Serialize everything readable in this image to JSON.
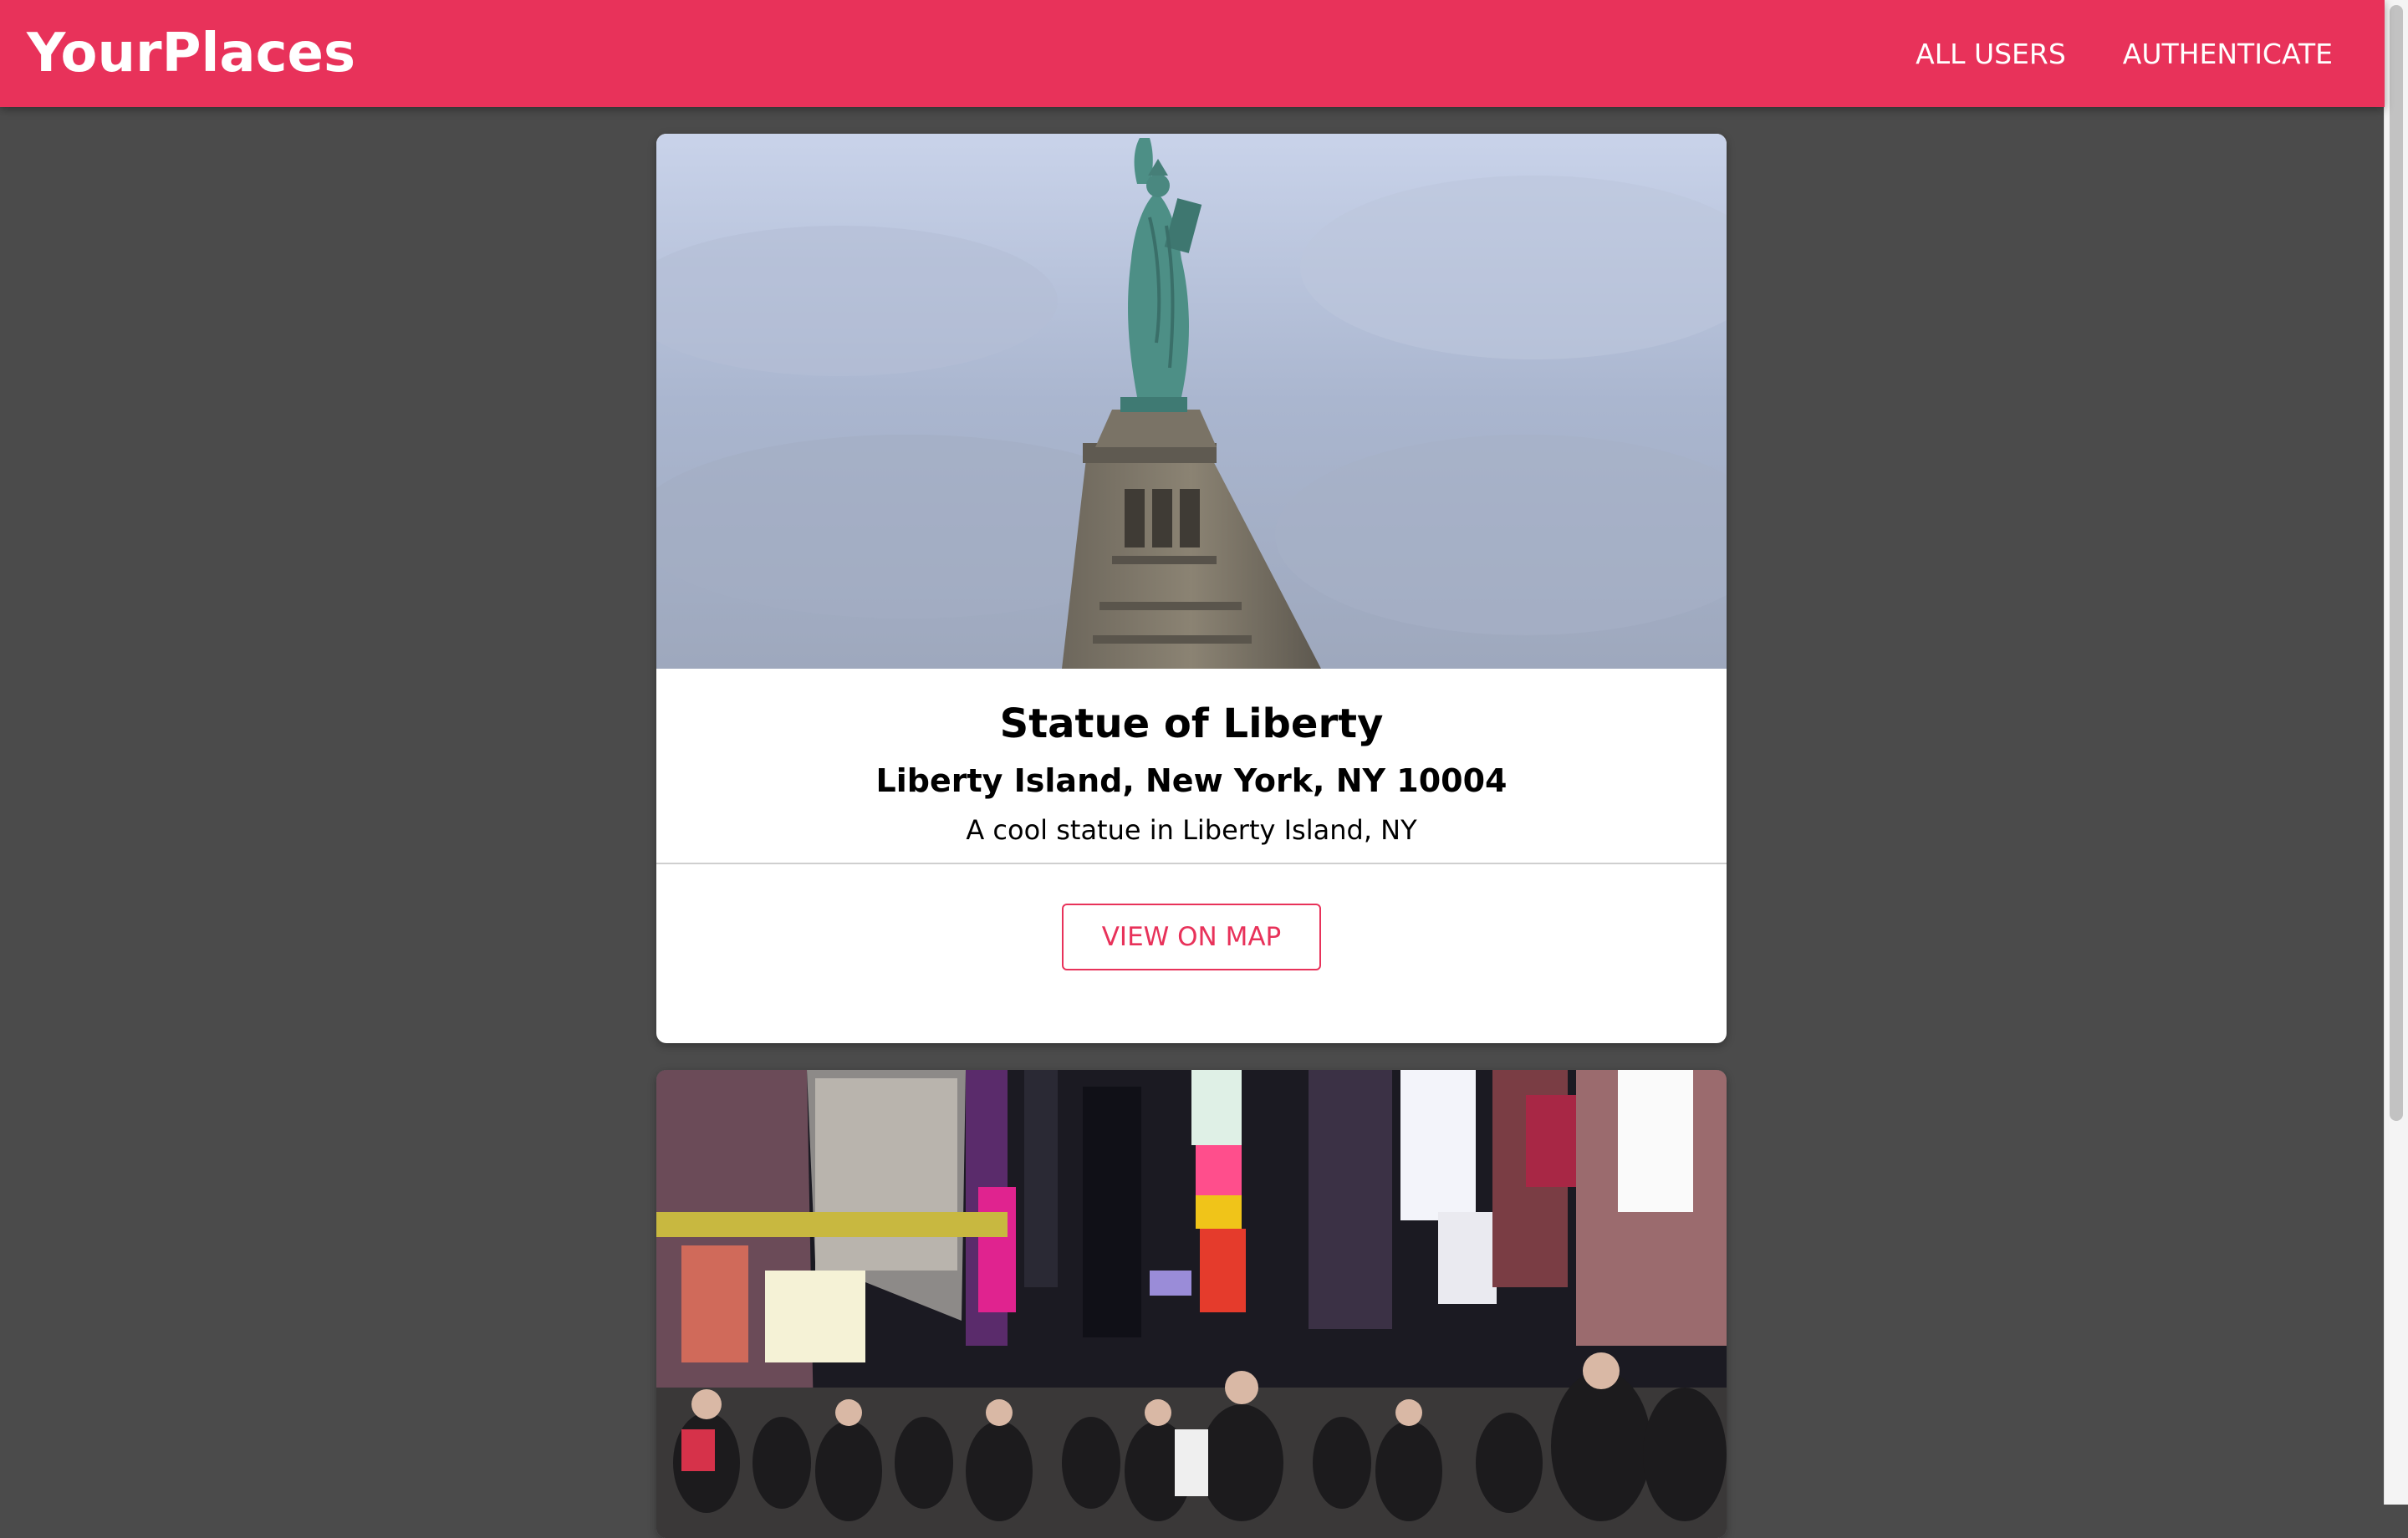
{
  "header": {
    "logo": "YourPlaces",
    "nav": [
      {
        "label": "ALL USERS"
      },
      {
        "label": "AUTHENTICATE"
      }
    ]
  },
  "places": [
    {
      "title": "Statue of Liberty",
      "address": "Liberty Island, New York, NY 10004",
      "description": "A cool statue in Liberty Island, NY",
      "action_label": "VIEW ON MAP",
      "image_subject": "statue-of-liberty-photo"
    },
    {
      "image_subject": "times-square-photo"
    }
  ],
  "colors": {
    "brand": "#e8325a",
    "page_background": "#4b4b4b",
    "card_background": "#ffffff"
  }
}
